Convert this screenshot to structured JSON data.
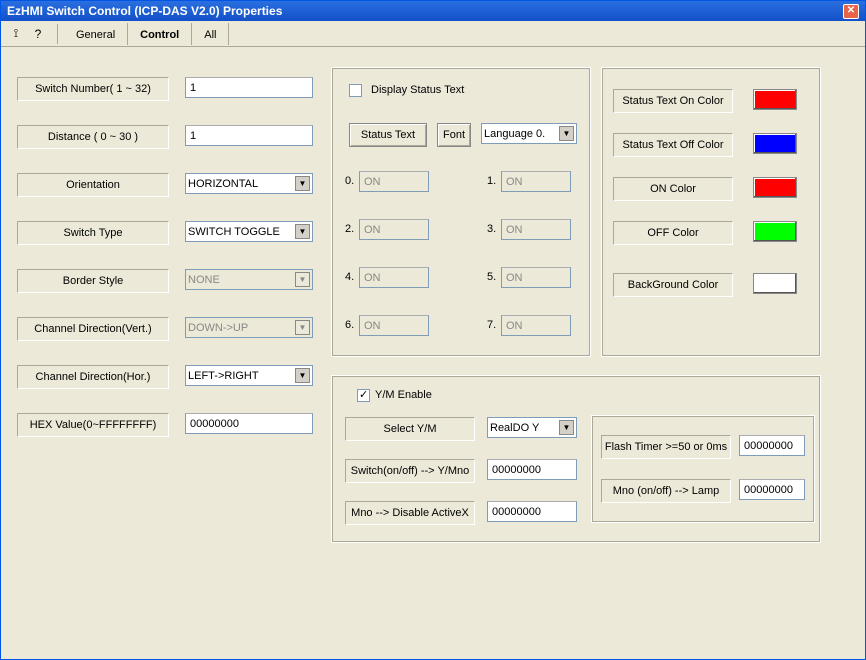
{
  "window": {
    "title": "EzHMI Switch Control (ICP-DAS V2.0) Properties"
  },
  "tabs": {
    "general": "General",
    "control": "Control",
    "all": "All"
  },
  "left": {
    "switch_number": {
      "label": "Switch Number( 1 ~ 32)",
      "value": "1"
    },
    "distance": {
      "label": "Distance ( 0 ~ 30 )",
      "value": "1"
    },
    "orientation": {
      "label": "Orientation",
      "value": "HORIZONTAL"
    },
    "switch_type": {
      "label": "Switch Type",
      "value": "SWITCH TOGGLE"
    },
    "border_style": {
      "label": "Border Style",
      "value": "NONE"
    },
    "ch_vert": {
      "label": "Channel Direction(Vert.)",
      "value": "DOWN->UP"
    },
    "ch_hor": {
      "label": "Channel Direction(Hor.)",
      "value": "LEFT->RIGHT"
    },
    "hex": {
      "label": "HEX Value(0~FFFFFFFF)",
      "value": "00000000"
    }
  },
  "status": {
    "display_status_text": "Display Status Text",
    "status_text_btn": "Status Text",
    "font_btn": "Font",
    "language": "Language 0.",
    "items": [
      "ON",
      "ON",
      "ON",
      "ON",
      "ON",
      "ON",
      "ON",
      "ON"
    ],
    "idx": [
      "0.",
      "1.",
      "2.",
      "3.",
      "4.",
      "5.",
      "6.",
      "7."
    ]
  },
  "colors": {
    "on_text": {
      "label": "Status Text On Color",
      "color": "#ff0000"
    },
    "off_text": {
      "label": "Status Text Off Color",
      "color": "#0000ff"
    },
    "on": {
      "label": "ON Color",
      "color": "#ff0000"
    },
    "off": {
      "label": "OFF Color",
      "color": "#00ff00"
    },
    "bg": {
      "label": "BackGround Color",
      "color": "#ffffff"
    }
  },
  "ym": {
    "enable": "Y/M Enable",
    "select": {
      "label": "Select Y/M",
      "value": "RealDO Y"
    },
    "switch_ymno": {
      "label": "Switch(on/off) --> Y/Mno",
      "value": "00000000"
    },
    "mno_disable": {
      "label": "Mno --> Disable ActiveX",
      "value": "00000000"
    },
    "flash": {
      "label": "Flash Timer >=50 or 0ms",
      "value": "00000000"
    },
    "mno_lamp": {
      "label": "Mno (on/off) --> Lamp",
      "value": "00000000"
    }
  }
}
